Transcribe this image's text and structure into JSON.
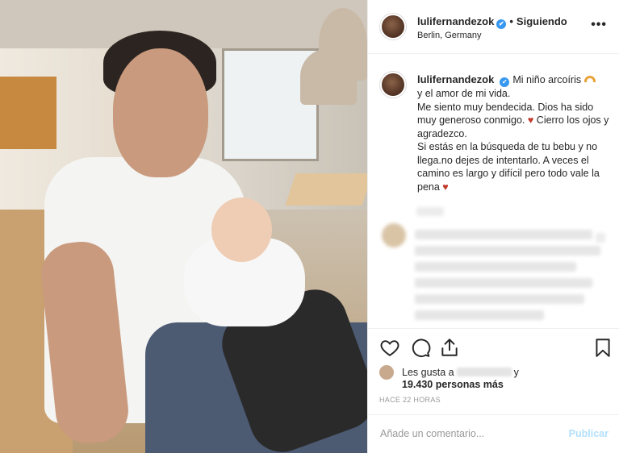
{
  "post": {
    "username": "lulifernandezok",
    "verified_glyph": "✔",
    "separator": "•",
    "follow_label": "Siguiendo",
    "location": "Berlin, Germany",
    "more_glyph": "•••",
    "caption": {
      "username": "lulifernandezok",
      "line1": "Mi niño arcoíris",
      "line2": "y el amor de mi vida.",
      "line3": "Me siento muy bendecida. Dios ha sido muy generoso conmigo.",
      "heart": "♥",
      "line4": "Cierro los ojos y agradezco.",
      "line5": "Si estás en la búsqueda de tu bebu y no llega.no dejes de intentarlo. A veces el camino es largo y difícil pero todo vale la pena"
    },
    "likes": {
      "prefix": "Les gusta a",
      "suffix": "y",
      "count_text": "19.430 personas más"
    },
    "timestamp": "HACE 22 HORAS",
    "comment_placeholder": "Añade un comentario...",
    "publish_label": "Publicar"
  },
  "icons": [
    "heart-icon",
    "comment-icon",
    "share-icon",
    "bookmark-icon",
    "rainbow-icon",
    "verified-icon",
    "more-icon"
  ],
  "colors": {
    "verified_blue": "#3897f0",
    "publish_disabled": "#b2dffc",
    "heart_red": "#c0392b",
    "muted_text": "#999999",
    "border": "#efefef"
  }
}
